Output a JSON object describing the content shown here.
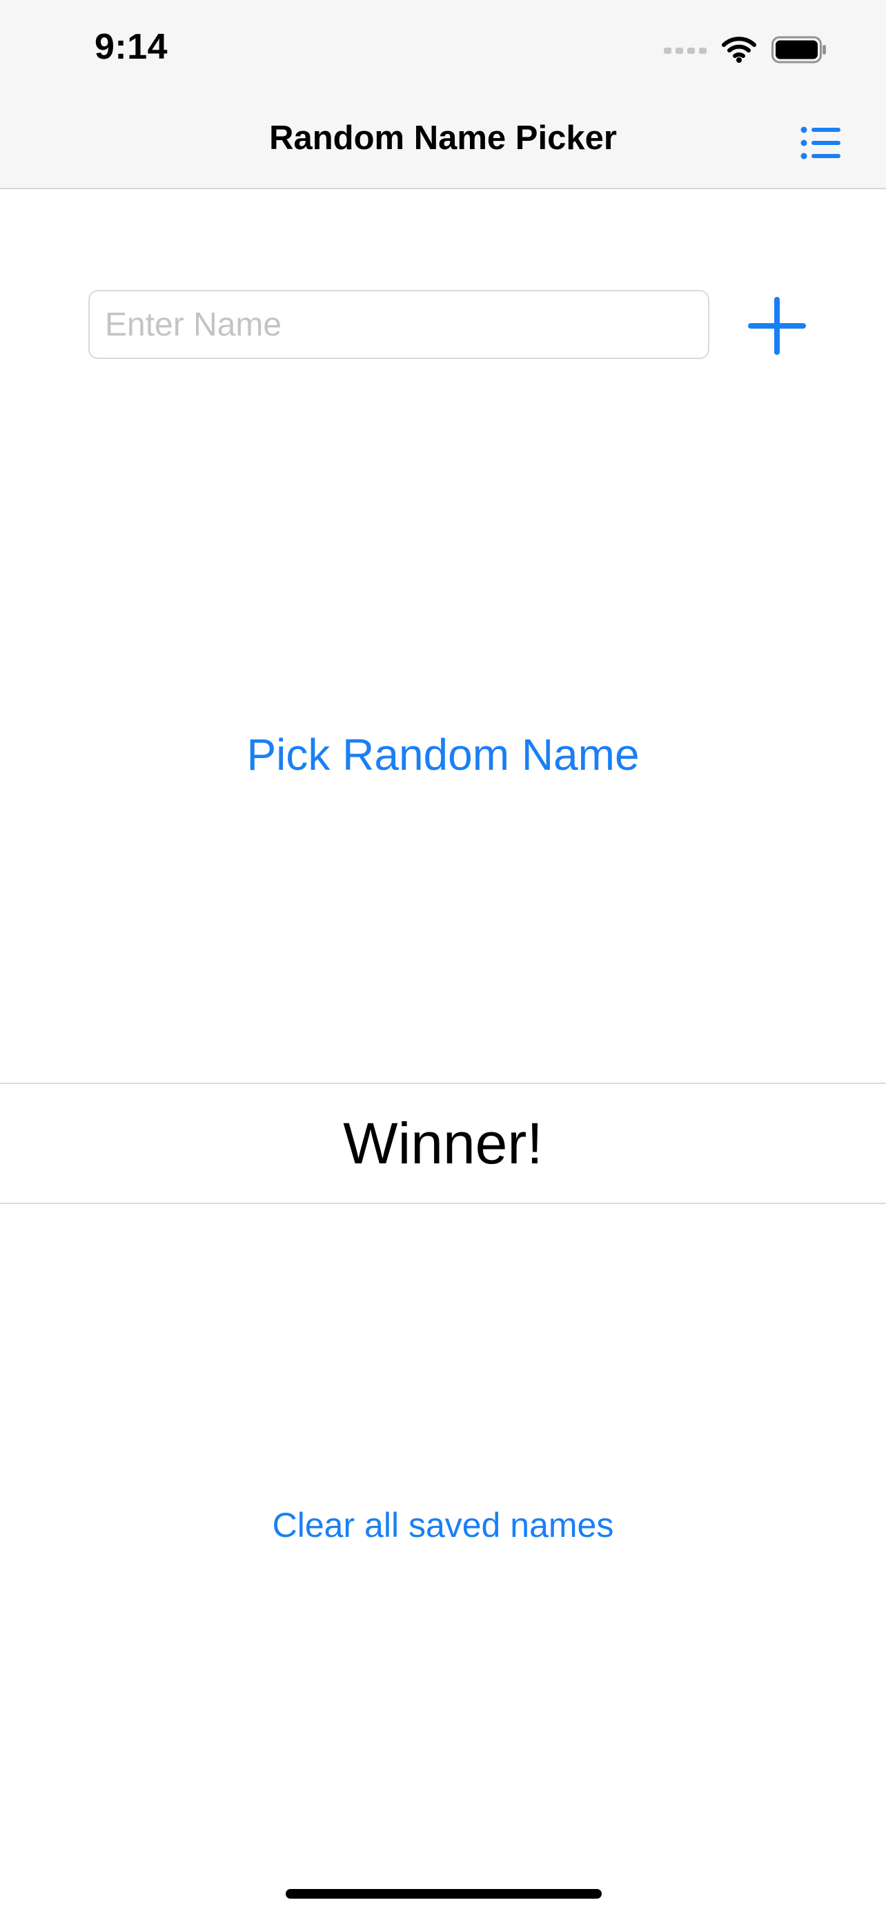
{
  "status_bar": {
    "time": "9:14",
    "icons": [
      "cellular-signal-icon",
      "wifi-icon",
      "battery-icon"
    ]
  },
  "nav_bar": {
    "title": "Random Name Picker",
    "right_icon": "list-icon"
  },
  "name_entry": {
    "value": "",
    "placeholder": "Enter Name",
    "add_icon": "plus-icon"
  },
  "actions": {
    "pick_label": "Pick Random Name",
    "clear_label": "Clear all saved names"
  },
  "result": {
    "winner_label": "Winner!"
  },
  "colors": {
    "accent": "#1a7ff5",
    "nav_background": "#f6f6f6",
    "placeholder": "#c4c4c7",
    "separator": "#dcdcde"
  }
}
